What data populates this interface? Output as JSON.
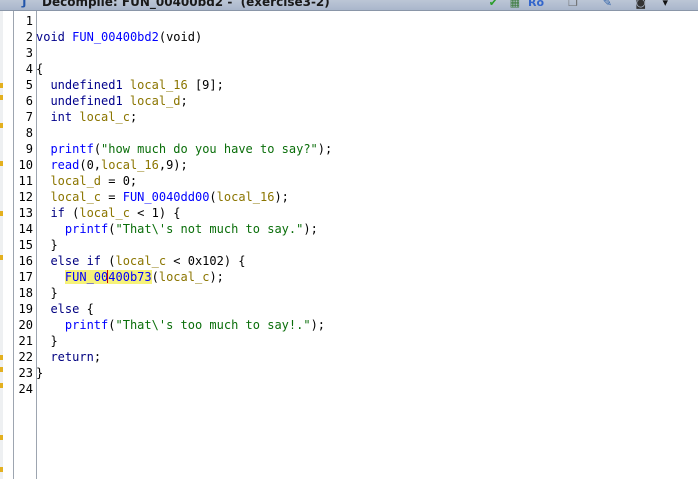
{
  "window": {
    "title": "Decompile: FUN_00400bd2 -  (exercise3-2)",
    "title_icon": "decompile-icon",
    "toolbar_icons": [
      "refresh-icon",
      "graph-icon",
      "ro-icon",
      "copy-icon",
      "edit-icon",
      "snapshot-icon",
      "menu-chevron-icon"
    ],
    "ro_label": "Ro"
  },
  "colors": {
    "keyword": "#000080",
    "function": "#0000ff",
    "variable": "#8b7500",
    "string": "#0a6e0a",
    "highlight": "#f6f27a",
    "caret": "#cc0000"
  },
  "editor": {
    "line_numbers": [
      "1",
      "2",
      "3",
      "4",
      "5",
      "6",
      "7",
      "8",
      "9",
      "10",
      "11",
      "12",
      "13",
      "14",
      "15",
      "16",
      "17",
      "18",
      "19",
      "20",
      "21",
      "22",
      "23",
      "24"
    ],
    "lines": [
      [],
      [
        {
          "t": "void",
          "c": "type"
        },
        {
          "t": " "
        },
        {
          "t": "FUN_00400bd2",
          "c": "fn"
        },
        {
          "t": "(void)"
        }
      ],
      [],
      [
        {
          "t": "{"
        }
      ],
      [
        {
          "t": "  undefined1 ",
          "c": "type"
        },
        {
          "t": "local_16",
          "c": "var"
        },
        {
          "t": " [9];"
        }
      ],
      [
        {
          "t": "  undefined1 ",
          "c": "type"
        },
        {
          "t": "local_d",
          "c": "var"
        },
        {
          "t": ";"
        }
      ],
      [
        {
          "t": "  int ",
          "c": "type"
        },
        {
          "t": "local_c",
          "c": "var"
        },
        {
          "t": ";"
        }
      ],
      [],
      [
        {
          "t": "  "
        },
        {
          "t": "printf",
          "c": "fn"
        },
        {
          "t": "("
        },
        {
          "t": "\"how much do you have to say?\"",
          "c": "str"
        },
        {
          "t": ");"
        }
      ],
      [
        {
          "t": "  "
        },
        {
          "t": "read",
          "c": "fn"
        },
        {
          "t": "(0,"
        },
        {
          "t": "local_16",
          "c": "var"
        },
        {
          "t": ",9);"
        }
      ],
      [
        {
          "t": "  "
        },
        {
          "t": "local_d",
          "c": "var"
        },
        {
          "t": " = 0;"
        }
      ],
      [
        {
          "t": "  "
        },
        {
          "t": "local_c",
          "c": "var"
        },
        {
          "t": " = "
        },
        {
          "t": "FUN_0040dd00",
          "c": "fn"
        },
        {
          "t": "("
        },
        {
          "t": "local_16",
          "c": "var"
        },
        {
          "t": ");"
        }
      ],
      [
        {
          "t": "  "
        },
        {
          "t": "if",
          "c": "kw"
        },
        {
          "t": " ("
        },
        {
          "t": "local_c",
          "c": "var"
        },
        {
          "t": " < 1) {"
        }
      ],
      [
        {
          "t": "    "
        },
        {
          "t": "printf",
          "c": "fn"
        },
        {
          "t": "("
        },
        {
          "t": "\"That\\'s not much to say.\"",
          "c": "str"
        },
        {
          "t": ");"
        }
      ],
      [
        {
          "t": "  }"
        }
      ],
      [
        {
          "t": "  "
        },
        {
          "t": "else if",
          "c": "kw"
        },
        {
          "t": " ("
        },
        {
          "t": "local_c",
          "c": "var"
        },
        {
          "t": " < 0x102) {"
        }
      ],
      [
        {
          "t": "    "
        },
        {
          "t": "FUN_00",
          "c": "fn hl"
        },
        {
          "t": "CARET"
        },
        {
          "t": "400b73",
          "c": "fn hl"
        },
        {
          "t": "("
        },
        {
          "t": "local_c",
          "c": "var"
        },
        {
          "t": ");"
        }
      ],
      [
        {
          "t": "  }"
        }
      ],
      [
        {
          "t": "  "
        },
        {
          "t": "else",
          "c": "kw"
        },
        {
          "t": " {"
        }
      ],
      [
        {
          "t": "    "
        },
        {
          "t": "printf",
          "c": "fn"
        },
        {
          "t": "("
        },
        {
          "t": "\"That\\'s too much to say!.\"",
          "c": "str"
        },
        {
          "t": ");"
        }
      ],
      [
        {
          "t": "  }"
        }
      ],
      [
        {
          "t": "  "
        },
        {
          "t": "return",
          "c": "kw"
        },
        {
          "t": ";"
        }
      ],
      [
        {
          "t": "}"
        }
      ],
      []
    ]
  }
}
